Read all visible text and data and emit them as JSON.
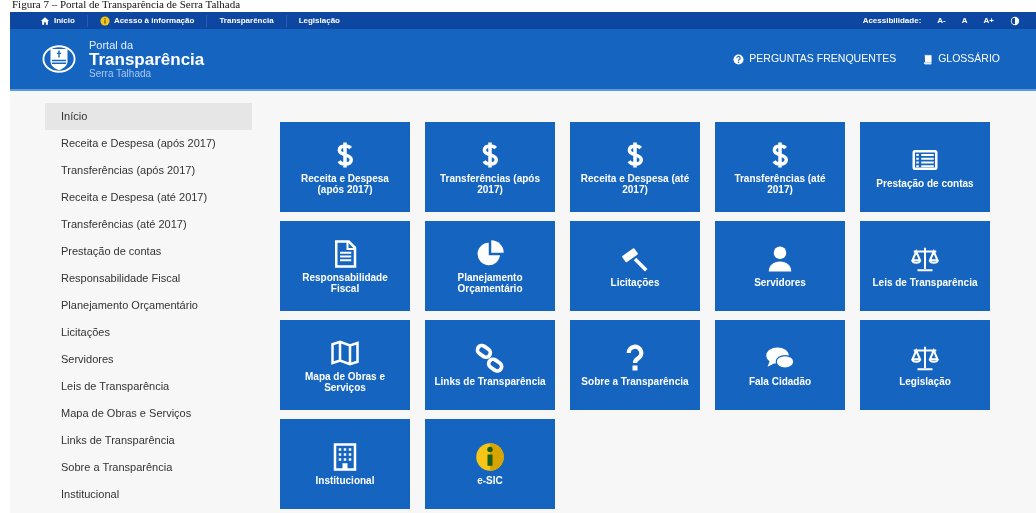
{
  "caption": "Figura 7 – Portal de Transparência de Serra Talhada",
  "topbar": {
    "links": [
      {
        "label": "Início",
        "kind": "home"
      },
      {
        "label": "Acesso à informação",
        "kind": "info"
      },
      {
        "label": "Transparência",
        "kind": "plain"
      },
      {
        "label": "Legislação",
        "kind": "plain"
      }
    ],
    "accessibility_label": "Acessibilidade:",
    "font_buttons": [
      "A-",
      "A",
      "A+"
    ]
  },
  "header": {
    "title_small": "Portal da",
    "title": "Transparência",
    "subtitle": "Serra Talhada",
    "links": [
      {
        "label": "PERGUNTAS FRENQUENTES",
        "kind": "question"
      },
      {
        "label": "GLOSSÁRIO",
        "kind": "book"
      }
    ]
  },
  "sidebar": {
    "items": [
      {
        "label": "Início",
        "selected": true
      },
      {
        "label": "Receita e Despesa (após 2017)",
        "selected": false
      },
      {
        "label": "Transferências (após 2017)",
        "selected": false
      },
      {
        "label": "Receita e Despesa (até 2017)",
        "selected": false
      },
      {
        "label": "Transferências (até 2017)",
        "selected": false
      },
      {
        "label": "Prestação de contas",
        "selected": false
      },
      {
        "label": "Responsabilidade Fiscal",
        "selected": false
      },
      {
        "label": "Planejamento Orçamentário",
        "selected": false
      },
      {
        "label": "Licitações",
        "selected": false
      },
      {
        "label": "Servidores",
        "selected": false
      },
      {
        "label": "Leis de Transparência",
        "selected": false
      },
      {
        "label": "Mapa de Obras e Serviços",
        "selected": false
      },
      {
        "label": "Links de Transparência",
        "selected": false
      },
      {
        "label": "Sobre a Transparência",
        "selected": false
      },
      {
        "label": "Institucional",
        "selected": false
      }
    ]
  },
  "tiles": [
    {
      "label": "Receita e Despesa (após 2017)",
      "kind": "dollar"
    },
    {
      "label": "Transferências (após 2017)",
      "kind": "dollar"
    },
    {
      "label": "Receita e Despesa (até 2017)",
      "kind": "dollar"
    },
    {
      "label": "Transferências (até 2017)",
      "kind": "dollar"
    },
    {
      "label": "Prestação de contas",
      "kind": "list"
    },
    {
      "label": "Responsabilidade Fiscal",
      "kind": "document"
    },
    {
      "label": "Planejamento Orçamentário",
      "kind": "pie"
    },
    {
      "label": "Licitações",
      "kind": "gavel"
    },
    {
      "label": "Servidores",
      "kind": "person"
    },
    {
      "label": "Leis de Transparência",
      "kind": "scale"
    },
    {
      "label": "Mapa de Obras e Serviços",
      "kind": "map"
    },
    {
      "label": "Links de Transparência",
      "kind": "link"
    },
    {
      "label": "Sobre a Transparência",
      "kind": "question"
    },
    {
      "label": "Fala Cidadão",
      "kind": "chat"
    },
    {
      "label": "Legislação",
      "kind": "scale"
    },
    {
      "label": "Institucional",
      "kind": "building"
    },
    {
      "label": "e-SIC",
      "kind": "info"
    }
  ]
}
